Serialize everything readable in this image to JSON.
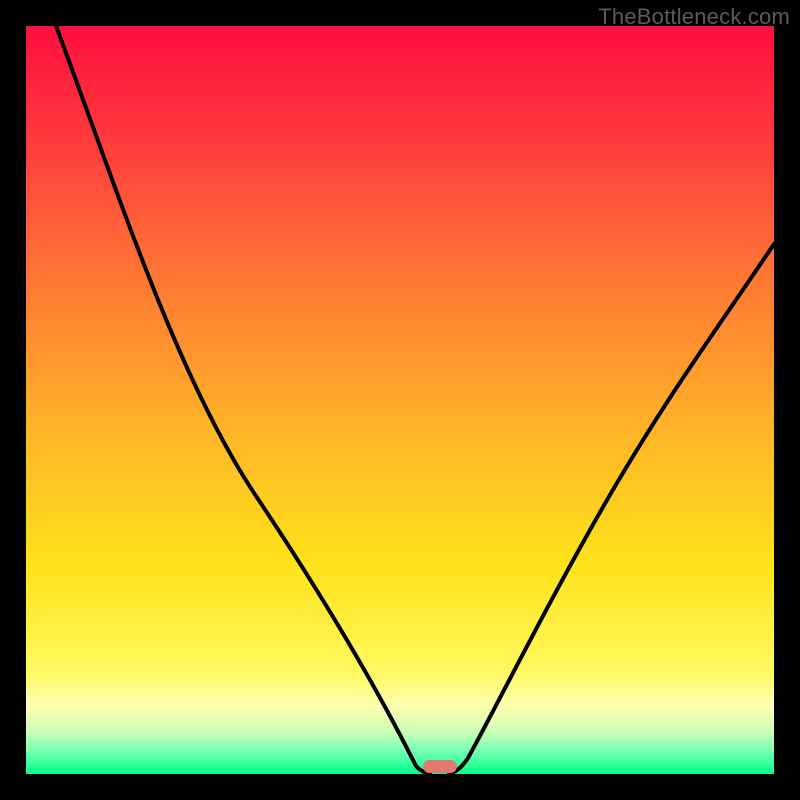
{
  "watermark": "TheBottleneck.com",
  "accent_color": "#e2786e",
  "curve_color": "#000000",
  "chart_data": {
    "type": "line",
    "title": "",
    "xlabel": "",
    "ylabel": "",
    "xlim": [
      0,
      100
    ],
    "ylim": [
      0,
      100
    ],
    "grid": false,
    "legend": false,
    "series": [
      {
        "name": "left-branch",
        "x": [
          4,
          10,
          18,
          26,
          32,
          38,
          44,
          50,
          52.5,
          54
        ],
        "y": [
          100,
          89,
          75,
          60,
          47,
          33,
          18,
          3,
          0.2,
          0
        ]
      },
      {
        "name": "right-branch",
        "x": [
          56.5,
          59,
          63,
          68,
          74,
          82,
          90,
          100
        ],
        "y": [
          0,
          2,
          9,
          19,
          31,
          45,
          57,
          71
        ]
      }
    ],
    "marker": {
      "x": 55.3,
      "y": 0,
      "shape": "rounded-rect"
    }
  }
}
